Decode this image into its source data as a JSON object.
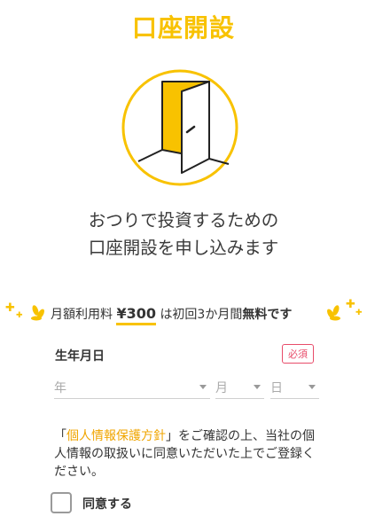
{
  "header": {
    "title": "口座開設"
  },
  "hero": {
    "subtitle_line1": "おつりで投資するための",
    "subtitle_line2": "口座開設を申し込みます"
  },
  "fee": {
    "prefix": "月額利用料",
    "price": "¥300",
    "middle": "は初回3か月間",
    "free": "無料です"
  },
  "form": {
    "dob_label": "生年月日",
    "required_badge": "必須",
    "year_placeholder": "年",
    "month_placeholder": "月",
    "day_placeholder": "日"
  },
  "consent": {
    "open_bracket": "「",
    "policy_link": "個人情報保護方針",
    "rest": "」をご確認の上、当社の個人情報の取扱いに同意いただいた上でご登録ください。",
    "agree_label": "同意する"
  },
  "colors": {
    "accent": "#f8c200",
    "required": "#e84c6a",
    "link": "#f0a500"
  }
}
